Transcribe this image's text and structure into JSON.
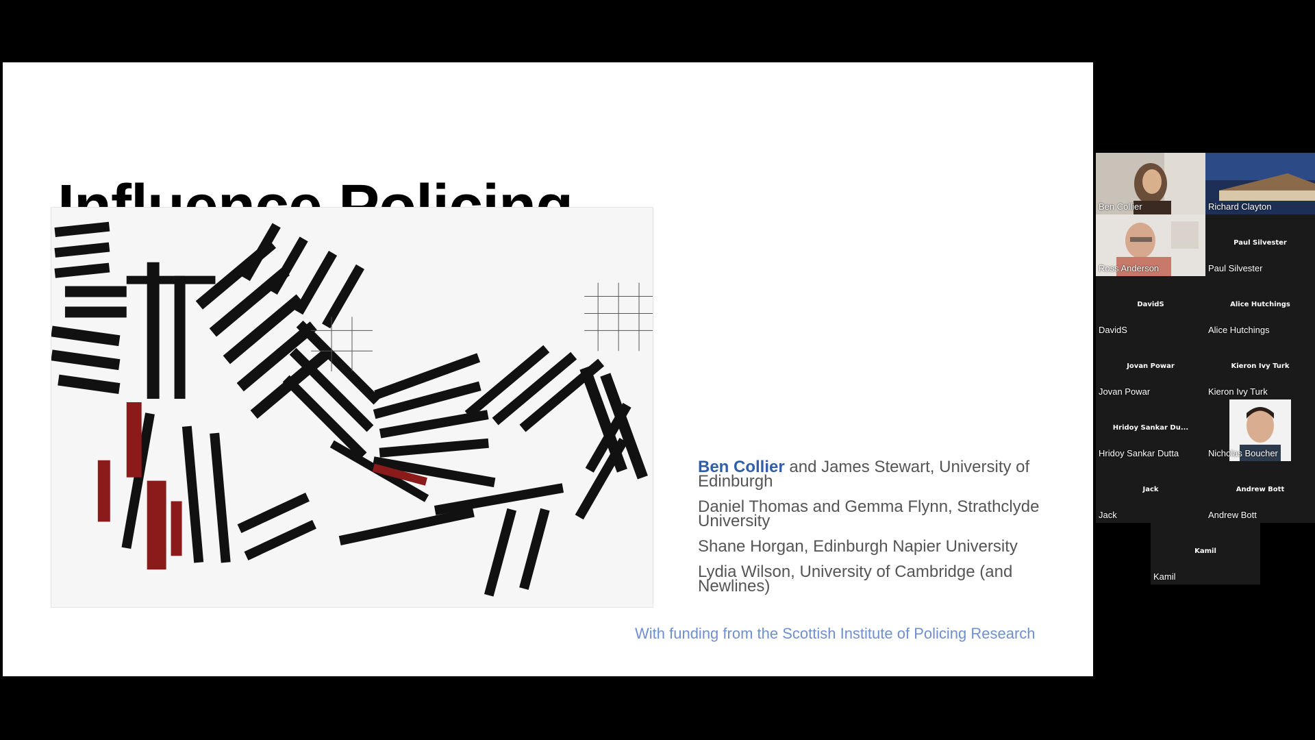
{
  "slide": {
    "title": "Influence Policing",
    "credits": [
      {
        "lead": "Ben Collier",
        "text": " and James Stewart, University of Edinburgh"
      },
      {
        "lead": "",
        "text": "Daniel Thomas and Gemma Flynn, Strathclyde University"
      },
      {
        "lead": "",
        "text": "Shane Horgan, Edinburgh Napier University"
      },
      {
        "lead": "",
        "text": "Lydia Wilson, University of Cambridge (and Newlines)"
      }
    ],
    "funding": "With funding from the Scottish Institute of Policing Research"
  },
  "controls": [
    {
      "name": "previous-slide-icon"
    },
    {
      "name": "pen-icon"
    },
    {
      "name": "closed-captions-icon"
    },
    {
      "name": "camera-off-icon"
    },
    {
      "name": "more-options-icon"
    },
    {
      "name": "next-slide-icon"
    }
  ],
  "participants": [
    {
      "name": "Ben Collier",
      "video": true
    },
    {
      "name": "Richard Clayton",
      "video": true
    },
    {
      "name": "Ross Anderson",
      "video": true
    },
    {
      "name": "Paul Silvester",
      "center": "Paul Silvester"
    },
    {
      "name": "DavidS",
      "center": "DavidS"
    },
    {
      "name": "Alice Hutchings",
      "center": "Alice Hutchings"
    },
    {
      "name": "Jovan Powar",
      "center": "Jovan Powar"
    },
    {
      "name": "Kieron Ivy Turk",
      "center": "Kieron Ivy Turk"
    },
    {
      "name": "Hridoy Sankar Dutta",
      "center": "Hridoy Sankar Du..."
    },
    {
      "name": "Nicholas Boucher",
      "video": true
    },
    {
      "name": "Jack",
      "center": "Jack"
    },
    {
      "name": "Andrew Bott",
      "center": "Andrew Bott"
    },
    {
      "name": "Kamil",
      "center": "Kamil"
    }
  ],
  "colors": {
    "accent": "#2f5fa8",
    "funding": "#6f8fcf",
    "tile_bg": "#1a1a1a",
    "art_red": "#8b1a1a"
  }
}
